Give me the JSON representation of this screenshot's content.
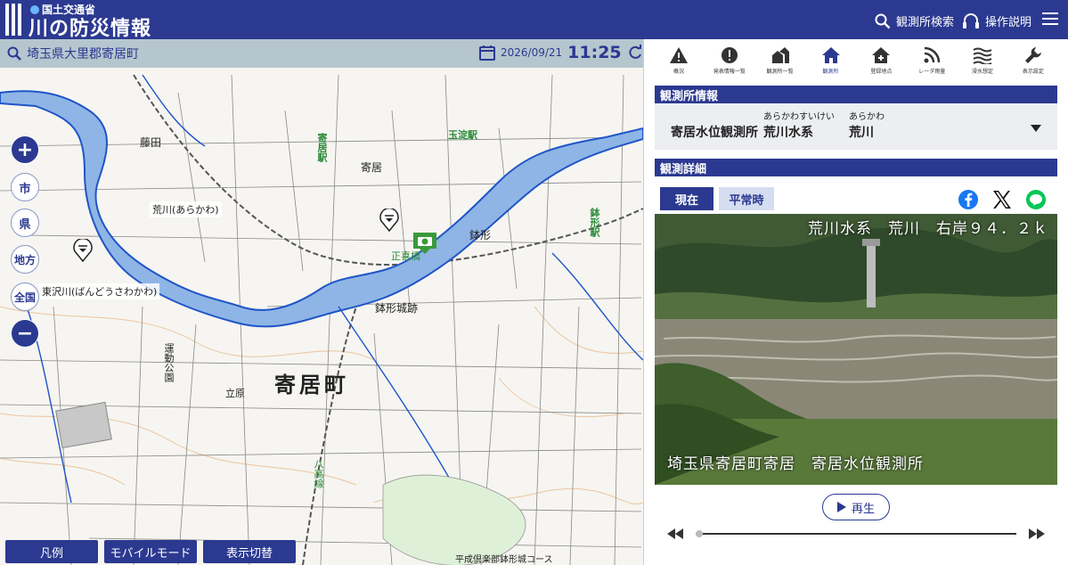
{
  "header": {
    "ministry": "国土交通省",
    "title": "川の防災情報",
    "search_label": "観測所検索",
    "help_label": "操作説明"
  },
  "map": {
    "location": "埼玉県大里郡寄居町",
    "date": "2026/09/21",
    "time": "11:25",
    "controls": [
      "市",
      "県",
      "地方",
      "全国"
    ],
    "labels": {
      "river_arakawa": "荒川(あらかわ)",
      "river_bandousawa": "東沢川(ばんどうさわかわ)",
      "town": "寄居町",
      "castle": "鉢形城跡",
      "station_tamayodo": "玉淀駅",
      "station_yorii": "寄居駅",
      "station_hachigata": "鉢形駅",
      "place_yorii": "寄居",
      "place_hachigata": "鉢形",
      "place_fujita": "藤田",
      "place_tachihara": "立原",
      "park": "運動公園",
      "golf": "平成倶楽部鉢形城コース",
      "bridge": "正喜橋",
      "rail_hachiko": "八高線"
    },
    "bottom_buttons": [
      "凡例",
      "モバイルモード",
      "表示切替"
    ]
  },
  "toolbar": {
    "items": [
      {
        "label": "概況",
        "icon": "warning-icon"
      },
      {
        "label": "発表情報一覧",
        "icon": "alert-icon"
      },
      {
        "label": "観測所一覧",
        "icon": "houses-icon"
      },
      {
        "label": "観測所",
        "icon": "home-icon",
        "active": true
      },
      {
        "label": "登録地点",
        "icon": "home-plus-icon"
      },
      {
        "label": "レーダ雨量",
        "icon": "rss-icon"
      },
      {
        "label": "浸水想定",
        "icon": "waves-icon"
      },
      {
        "label": "表示設定",
        "icon": "wrench-icon"
      }
    ]
  },
  "station_info": {
    "heading": "観測所情報",
    "name": "寄居水位観測所",
    "system_ruby": "あらかわすいけい",
    "system": "荒川水系",
    "river_ruby": "あらかわ",
    "river": "荒川"
  },
  "detail": {
    "heading": "観測詳細",
    "tab_now": "現在",
    "tab_normal": "平常時",
    "camera_caption_top": "荒川水系　荒川　右岸９４．２ｋ",
    "camera_caption_bottom": "埼玉県寄居町寄居　寄居水位観測所",
    "play_label": "再生",
    "playback_position": 0.0
  },
  "colors": {
    "brand": "#2b3990",
    "map_bar": "#b6c6cf",
    "river": "#1f55c8"
  }
}
